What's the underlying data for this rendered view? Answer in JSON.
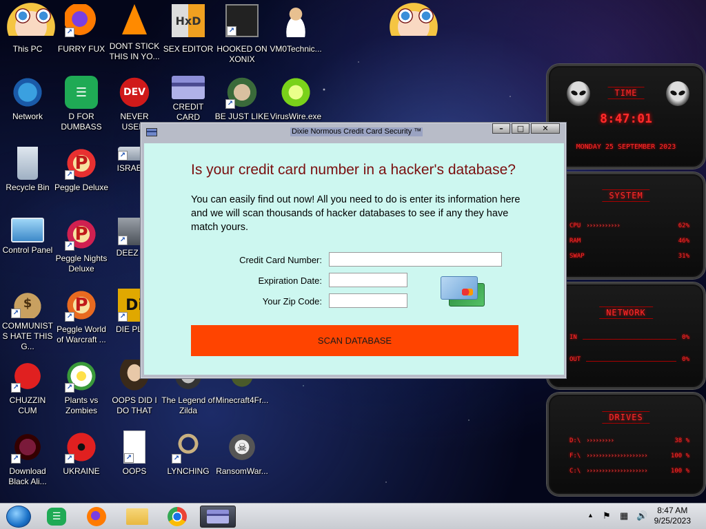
{
  "desktop": {
    "icons": [
      {
        "label": "This PC"
      },
      {
        "label": "FURRY FUX"
      },
      {
        "label": "DONT STICK THIS IN YO..."
      },
      {
        "label": "SEX EDITOR"
      },
      {
        "label": "HOOKED ON XONIX"
      },
      {
        "label": "VM0Technic..."
      },
      {
        "label": "Network"
      },
      {
        "label": "D FOR DUMBASS"
      },
      {
        "label": "NEVER USED!"
      },
      {
        "label": "CREDIT CARD CHECKER"
      },
      {
        "label": "BE JUST LIKE THE DUDE!"
      },
      {
        "label": "VirusWire.exe"
      },
      {
        "label": "Recycle Bin"
      },
      {
        "label": "Peggle Deluxe"
      },
      {
        "label": "ISRAELS"
      },
      {
        "label": "Control Panel"
      },
      {
        "label": "Peggle Nights Deluxe"
      },
      {
        "label": "DEEZ NU"
      },
      {
        "label": "COMMUNISTS HATE THIS G..."
      },
      {
        "label": "Peggle World of Warcraft ..."
      },
      {
        "label": "DIE PLEA"
      },
      {
        "label": "CHUZZIN CUM"
      },
      {
        "label": "Plants vs Zombies"
      },
      {
        "label": "OOPS DID I DO THAT"
      },
      {
        "label": "The Legend of Zilda"
      },
      {
        "label": "Minecraft4Fr..."
      },
      {
        "label": "Download Black Ali..."
      },
      {
        "label": "UKRAINE"
      },
      {
        "label": "OOPS"
      },
      {
        "label": "LYNCHING"
      },
      {
        "label": "RansomWar..."
      }
    ]
  },
  "widgets": {
    "time": {
      "title": "TIME",
      "clock": "8:47:01",
      "date": "MONDAY 25 SEPTEMBER 2023"
    },
    "system": {
      "title": "SYSTEM",
      "rows": [
        {
          "label": "CPU",
          "value": "62%",
          "level": 0.62
        },
        {
          "label": "RAM",
          "value": "46%",
          "level": 0.46
        },
        {
          "label": "SWAP",
          "value": "31%",
          "level": 0.31
        }
      ]
    },
    "network": {
      "title": "NETWORK",
      "rows": [
        {
          "label": "IN",
          "value": "0%"
        },
        {
          "label": "OUT",
          "value": "0%"
        }
      ]
    },
    "drives": {
      "title": "DRIVES",
      "rows": [
        {
          "label": "D:\\",
          "value": "38 %"
        },
        {
          "label": "F:\\",
          "value": "100 %"
        },
        {
          "label": "C:\\",
          "value": "100 %"
        }
      ]
    }
  },
  "window": {
    "title": "Dixie Normous Credit Card Security ™",
    "buttons": {
      "minimize": "–",
      "maximize": "□",
      "close": "✕"
    },
    "heading": "Is your credit card number in a hacker's database?",
    "intro": "You can easily find out now! All you need to do is enter its information here and we will scan thousands of hacker databases to see if any they have match yours.",
    "form": {
      "card_label": "Credit Card Number:",
      "card_value": "",
      "exp_label": "Expiration Date:",
      "exp_value": "",
      "zip_label": "Your Zip Code:",
      "zip_value": ""
    },
    "scan_button": "SCAN DATABASE",
    "cards_icon": "credit-cards-icon"
  },
  "taskbar": {
    "apps": [
      "start-orb",
      "notes-app",
      "firefox",
      "file-explorer",
      "chrome",
      "credit-card-checker"
    ],
    "time": "8:47 AM",
    "date": "9/25/2023"
  },
  "colors": {
    "content_bg": "#cdf7f0",
    "heading": "#7a0f0f",
    "scan_button": "#ff4400",
    "widget_red": "#ff2a2a"
  }
}
